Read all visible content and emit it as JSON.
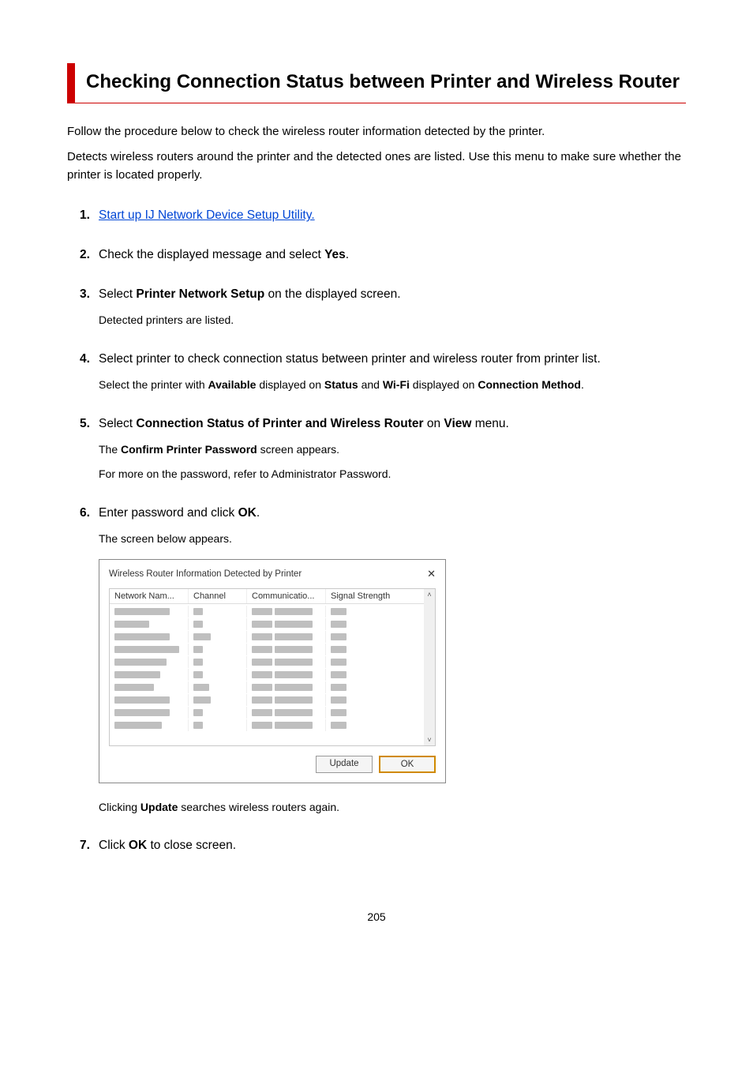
{
  "title": "Checking Connection Status between Printer and Wireless Router",
  "intro1": "Follow the procedure below to check the wireless router information detected by the printer.",
  "intro2": "Detects wireless routers around the printer and the detected ones are listed. Use this menu to make sure whether the printer is located properly.",
  "steps": {
    "s1": {
      "num": "1.",
      "link": "Start up IJ Network Device Setup Utility."
    },
    "s2": {
      "num": "2.",
      "pre": "Check the displayed message and select ",
      "bold": "Yes",
      "post": "."
    },
    "s3": {
      "num": "3.",
      "pre": "Select ",
      "bold": "Printer Network Setup",
      "post": " on the displayed screen.",
      "sub": "Detected printers are listed."
    },
    "s4": {
      "num": "4.",
      "text": "Select printer to check connection status between printer and wireless router from printer list.",
      "sub_pre": "Select the printer with ",
      "sub_b1": "Available",
      "sub_mid1": " displayed on ",
      "sub_b2": "Status",
      "sub_mid2": " and ",
      "sub_b3": "Wi-Fi",
      "sub_mid3": " displayed on ",
      "sub_b4": "Connection Method",
      "sub_post": "."
    },
    "s5": {
      "num": "5.",
      "pre": "Select ",
      "bold": "Connection Status of Printer and Wireless Router",
      "mid": " on ",
      "bold2": "View",
      "post": " menu.",
      "sub1_pre": "The ",
      "sub1_bold": "Confirm Printer Password",
      "sub1_post": " screen appears.",
      "sub2": "For more on the password, refer to Administrator Password."
    },
    "s6": {
      "num": "6.",
      "pre": "Enter password and click ",
      "bold": "OK",
      "post": ".",
      "sub": "The screen below appears.",
      "shot_sub_pre": "Clicking ",
      "shot_sub_bold": "Update",
      "shot_sub_post": " searches wireless routers again."
    },
    "s7": {
      "num": "7.",
      "pre": "Click ",
      "bold": "OK",
      "post": " to close screen."
    }
  },
  "dialog": {
    "title": "Wireless Router Information Detected by Printer",
    "columns": {
      "c1": "Network Nam...",
      "c2": "Channel",
      "c3": "Communicatio...",
      "c4": "Signal Strength"
    },
    "buttons": {
      "update": "Update",
      "ok": "OK"
    }
  },
  "page_number": "205"
}
